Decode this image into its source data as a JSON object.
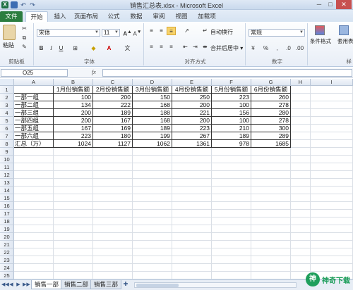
{
  "window": {
    "title": "销售汇总表.xlsx - Microsoft Excel",
    "controls": [
      "─",
      "□",
      "✕"
    ],
    "app_icon": "X"
  },
  "ribbon_tabs": [
    "文件",
    "开始",
    "插入",
    "页面布局",
    "公式",
    "数据",
    "审阅",
    "视图",
    "加载项"
  ],
  "ribbon": {
    "paste_label": "粘贴",
    "font_name": "宋体",
    "font_size": "11",
    "wrap_text": "自动换行",
    "merge_center": "合并后居中 ▾",
    "number_format": "常规",
    "conditional_format": "条件格式",
    "table_format": "套用表格格式",
    "groups": {
      "clipboard": "剪贴板",
      "font": "字体",
      "alignment": "对齐方式",
      "number": "数字",
      "styles": "样"
    }
  },
  "formula_bar": {
    "name_box": "O25",
    "fx": "fx",
    "content": ""
  },
  "grid": {
    "columns": [
      "A",
      "B",
      "C",
      "D",
      "E",
      "F",
      "G",
      "H",
      "I"
    ],
    "rows": [
      "1",
      "2",
      "3",
      "4",
      "5",
      "6",
      "7",
      "8",
      "9",
      "10",
      "11",
      "12",
      "13",
      "14",
      "15",
      "16",
      "17",
      "18",
      "19",
      "20",
      "21",
      "22",
      "23",
      "24",
      "25"
    ],
    "header": [
      "",
      "1月份销售额",
      "2月份销售额",
      "3月份销售额",
      "4月份销售额",
      "5月份销售额",
      "6月份销售额"
    ],
    "data": [
      [
        "一部一组",
        "100",
        "200",
        "150",
        "250",
        "223",
        "260"
      ],
      [
        "一部二组",
        "134",
        "222",
        "168",
        "200",
        "100",
        "278"
      ],
      [
        "一部三组",
        "200",
        "189",
        "188",
        "221",
        "156",
        "280"
      ],
      [
        "一部四组",
        "200",
        "167",
        "168",
        "200",
        "100",
        "278"
      ],
      [
        "一部五组",
        "167",
        "169",
        "189",
        "223",
        "210",
        "300"
      ],
      [
        "一部六组",
        "223",
        "180",
        "199",
        "267",
        "189",
        "289"
      ],
      [
        "汇总（万）",
        "1024",
        "1127",
        "1062",
        "1361",
        "978",
        "1685"
      ]
    ]
  },
  "sheets": {
    "tabs": [
      "销售一部",
      "销售二部",
      "销售三部"
    ],
    "active": 0,
    "nav": [
      "◀◀",
      "◀",
      "▶",
      "▶▶"
    ]
  },
  "watermark": {
    "logo": "神",
    "text": "神奇下载"
  }
}
